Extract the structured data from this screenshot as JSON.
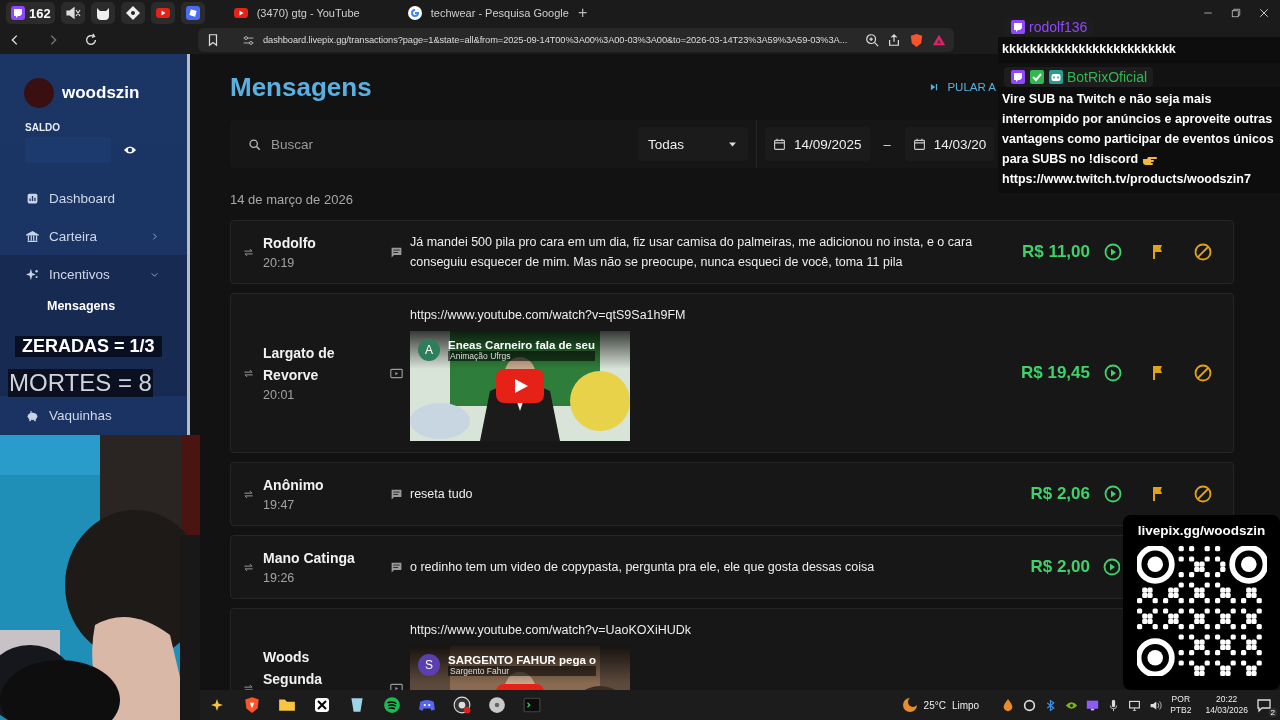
{
  "browser": {
    "pinned_tabs": [
      {
        "kind": "twitch",
        "badge": "162"
      },
      {
        "kind": "muted"
      },
      {
        "kind": "cat"
      },
      {
        "kind": "diamond"
      },
      {
        "kind": "youtube"
      },
      {
        "kind": "cube"
      }
    ],
    "tabs": [
      {
        "kind": "youtube",
        "title": "(3470) gtg - YouTube"
      },
      {
        "kind": "google",
        "title": "techwear - Pesquisa Google"
      }
    ],
    "new_tab": "+",
    "url": "dashboard.livepix.gg/transactions?page=1&state=all&from=2025-09-14T00%3A00%3A00-03%3A00&to=2026-03-14T23%3A59%3A59-03%3A..."
  },
  "sidebar": {
    "user": "woodszin",
    "balance_label": "SALDO",
    "items": [
      {
        "label": "Dashboard"
      },
      {
        "label": "Carteira",
        "expanded": false
      },
      {
        "label": "Incentivos",
        "expanded": true,
        "children": [
          {
            "label": "Mensagens",
            "selected": true
          }
        ]
      },
      {
        "label": "Vaquinhas"
      }
    ]
  },
  "page": {
    "title": "Mensagens",
    "skip_alert": "PULAR A",
    "search": {
      "placeholder": "Buscar"
    },
    "filter": "Todas",
    "date_from": "14/09/2025",
    "date_separator": "–",
    "date_to": "14/03/20",
    "date_heading": "14 de março de 2026"
  },
  "rows": [
    {
      "kind": "text",
      "name": "Rodolfo",
      "time": "20:19",
      "message": "Já mandei 500 pila pro cara em um dia, fiz usar camisa do palmeiras, me adicionou no insta, e o cara conseguiu esquecer de mim. Mas não se preocupe, nunca esqueci de você, toma 11 pila",
      "amount": "R$ 11,00"
    },
    {
      "kind": "video",
      "name": "Largato de Revorve",
      "time": "20:01",
      "url": "https://www.youtube.com/watch?v=qtS9Sa1h9FM",
      "video": {
        "avatar": "A",
        "color": "#2e7d5b",
        "title": "Eneas Carneiro fala de seu",
        "channel": "Animação Ufrgs"
      },
      "amount": "R$ 19,45"
    },
    {
      "kind": "text",
      "name": "Anônimo",
      "time": "19:47",
      "message": "reseta tudo",
      "amount": "R$ 2,06"
    },
    {
      "kind": "text",
      "name": "Mano Catinga",
      "time": "19:26",
      "message": "o redinho tem um video de copypasta, pergunta pra ele, ele que gosta dessas coisa",
      "amount": "R$ 2,00"
    },
    {
      "kind": "video",
      "name": "Woods Segunda",
      "url": "https://www.youtube.com/watch?v=UaoKOXiHUDk",
      "video": {
        "avatar": "S",
        "color": "#5b3fb0",
        "title": "SARGENTO FAHUR pega o",
        "channel": "Sargento Fahur"
      }
    }
  ],
  "chat": [
    {
      "user": "rodolf136",
      "color": "#9147ff",
      "badges": [
        {
          "kind": "twitch"
        }
      ],
      "text": "kkkkkkkkkkkkkkkkkkkkkkkkk"
    },
    {
      "user": "BotRixOficial",
      "color": "#2fb84f",
      "badges": [
        {
          "kind": "twitch"
        },
        {
          "kind": "check"
        },
        {
          "kind": "robot"
        }
      ],
      "text": "Vire SUB na Twitch e não seja mais interrompido por anúncios e aproveite outras vantagens como participar de eventos únicos para SUBS no !discord",
      "emote": {
        "kind": "point_right"
      },
      "link": "https://www.twitch.tv/products/woodszin7"
    }
  ],
  "counters": [
    {
      "text": "ZERADAS = 1/3",
      "kind": "bold"
    },
    {
      "text": "MORTES = 8",
      "kind": "light"
    }
  ],
  "qr": {
    "label": "livepix.gg/woodszin"
  },
  "taskbar": {
    "apps": [
      {
        "kind": "sparkle"
      },
      {
        "kind": "shield"
      },
      {
        "kind": "folder"
      },
      {
        "kind": "xbox"
      },
      {
        "kind": "glass"
      },
      {
        "kind": "waves"
      },
      {
        "kind": "gamepad"
      },
      {
        "kind": "record"
      },
      {
        "kind": "disc"
      },
      {
        "kind": "terminal"
      }
    ],
    "weather": {
      "temp": "25°C",
      "condition": "Limpo"
    },
    "tray": [
      {
        "kind": "drop"
      },
      {
        "kind": "circle"
      },
      {
        "kind": "bluetooth"
      },
      {
        "kind": "eye"
      },
      {
        "kind": "screen"
      },
      {
        "kind": "mic"
      },
      {
        "kind": "network"
      },
      {
        "kind": "speaker"
      }
    ],
    "language": "POR",
    "layout": "PTB2",
    "time": "20:22",
    "date": "14/03/2026",
    "notifications": "2"
  }
}
